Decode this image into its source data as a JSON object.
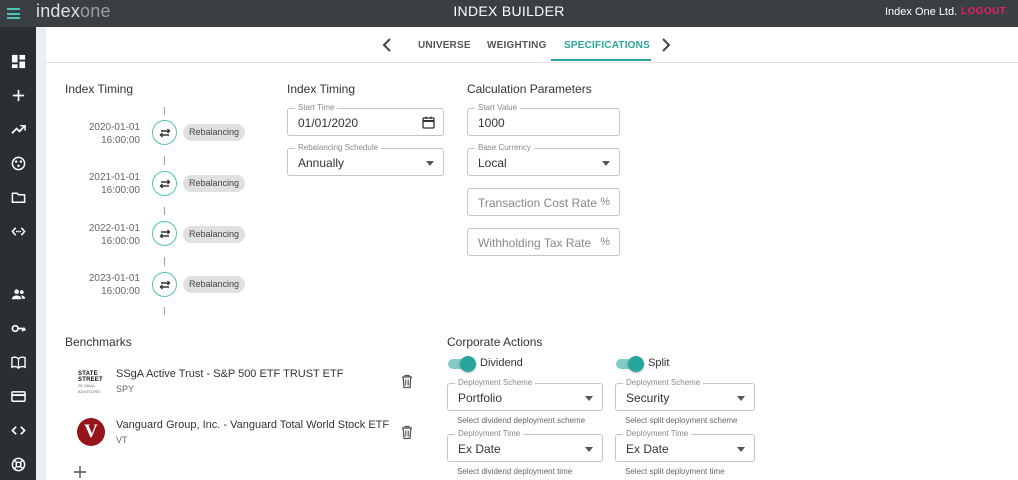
{
  "app": {
    "logo_part1": "index",
    "logo_part2": "one",
    "title": "INDEX BUILDER",
    "company": "Index One Ltd.",
    "logout": "LOGOUT",
    "accent": "#26a69a",
    "brand_pink": "#e91e63"
  },
  "sidebar": {
    "icons": [
      "dashboard-icon",
      "add-icon",
      "trending-icon",
      "scatter-icon",
      "folder-icon",
      "code-brackets-icon",
      "people-icon",
      "key-icon",
      "book-icon",
      "card-icon",
      "code-icon",
      "lifebuoy-icon"
    ]
  },
  "tabs": [
    {
      "label": "UNIVERSE"
    },
    {
      "label": "WEIGHTING"
    },
    {
      "label": "SPECIFICATIONS"
    }
  ],
  "timing": {
    "title": "Index Timing",
    "events": [
      {
        "date": "2020-01-01",
        "time": "16:00:00",
        "label": "Rebalancing"
      },
      {
        "date": "2021-01-01",
        "time": "16:00:00",
        "label": "Rebalancing"
      },
      {
        "date": "2022-01-01",
        "time": "16:00:00",
        "label": "Rebalancing"
      },
      {
        "date": "2023-01-01",
        "time": "16:00:00",
        "label": "Rebalancing"
      }
    ]
  },
  "index_timing_form": {
    "title": "Index Timing",
    "start_time_label": "Start Time",
    "start_time_value": "01/01/2020",
    "schedule_label": "Rebalancing Schedule",
    "schedule_value": "Annually"
  },
  "calc": {
    "title": "Calculation Parameters",
    "start_value_label": "Start Value",
    "start_value": "1000",
    "currency_label": "Base Currency",
    "currency_value": "Local",
    "tcr_placeholder": "Transaction Cost Rate",
    "wht_placeholder": "Withholding Tax Rate",
    "percent": "%"
  },
  "benchmarks": {
    "title": "Benchmarks",
    "items": [
      {
        "name": "SSgA Active Trust - S&P 500 ETF TRUST ETF",
        "ticker": "SPY",
        "logo_text": "STATE STREET"
      },
      {
        "name": "Vanguard Group, Inc. - Vanguard Total World Stock ETF",
        "ticker": "VT",
        "logo_text": "V"
      }
    ]
  },
  "corporate": {
    "title": "Corporate Actions",
    "dividend": {
      "label": "Dividend",
      "scheme_label": "Deployment Scheme",
      "scheme_value": "Portfolio",
      "scheme_helper": "Select dividend deployment scheme",
      "time_label": "Deployment Time",
      "time_value": "Ex Date",
      "time_helper": "Select dividend deployment time"
    },
    "split": {
      "label": "Split",
      "scheme_label": "Deployment Scheme",
      "scheme_value": "Security",
      "scheme_helper": "Select split deployment scheme",
      "time_label": "Deployment Time",
      "time_value": "Ex Date",
      "time_helper": "Select split deployment time"
    }
  }
}
